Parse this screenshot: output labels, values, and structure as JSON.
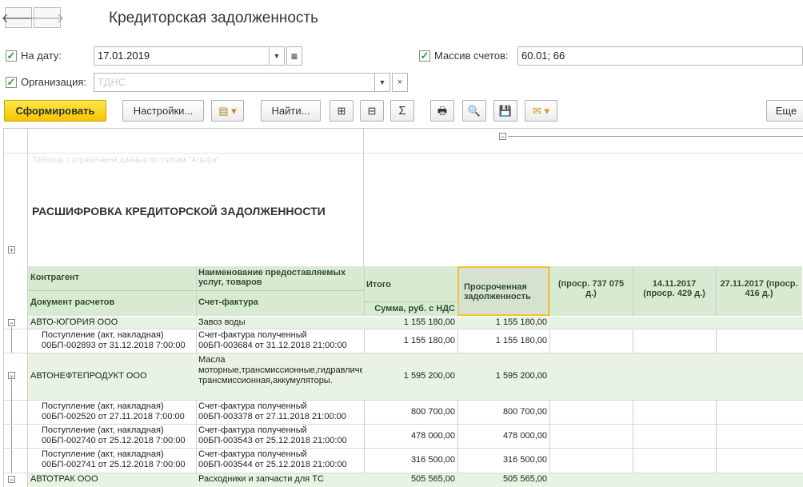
{
  "nav": {
    "back_icon": "arrow-left-icon",
    "forward_icon": "arrow-right-icon"
  },
  "window": {
    "title": "Кредиторская задолженность"
  },
  "filters": {
    "date_label": "На дату:",
    "date_value": "17.01.2019",
    "accounts_label": "Массив счетов:",
    "accounts_value": "60.01; 66",
    "org_label": "Организация:",
    "org_value": "ТДНС"
  },
  "toolbar": {
    "generate": "Сформировать",
    "settings": "Настройки...",
    "find": "Найти...",
    "sum_symbol": "Σ",
    "more": "Еще"
  },
  "report": {
    "subtitle": "Таблица с отражением данных по счетам \"Альфа\"",
    "title": "РАСШИФРОВКА КРЕДИТОРСКОЙ ЗАДОЛЖЕННОСТИ",
    "columns": {
      "counterparty": "Контрагент",
      "doc": "Документ расчетов",
      "service": "Наименование предоставляемых услуг, товаров",
      "invoice": "Счет-фактура",
      "total": "Итого",
      "sum": "Сумма, руб. с НДС",
      "overdue": "Просроченная задолженность",
      "c1": "(проср. 737 075 д.)",
      "c2": "14.11.2017 (проср. 429 д.)",
      "c3": "27.11.2017 (проср. 416 д.)"
    },
    "rows": [
      {
        "a": "АВТО-ЮГОРИЯ ООО",
        "b": "Завоз воды",
        "t": "1 155 180,00",
        "o": "1 155 180,00"
      },
      {
        "a": "Поступление (акт, накладная)",
        "a2": "00БП-002893 от 31.12.2018 7:00:00",
        "b": "Счет-фактура полученный",
        "b2": "00БП-003684 от 31.12.2018 21:00:00",
        "t": "1 155 180,00",
        "o": "1 155 180,00"
      },
      {
        "a": "АВТОНЕФТЕПРОДУКТ ООО",
        "b": "Масла моторные,трансмиссионные,гидравлические,жидкость трансмиссионная,аккумуляторы.",
        "t": "1 595 200,00",
        "o": "1 595 200,00"
      },
      {
        "a": "Поступление (акт, накладная)",
        "a2": "00БП-002520 от 27.11.2018 7:00:00",
        "b": "Счет-фактура полученный",
        "b2": "00БП-003378 от 27.11.2018 21:00:00",
        "t": "800 700,00",
        "o": "800 700,00"
      },
      {
        "a": "Поступление (акт, накладная)",
        "a2": "00БП-002740 от 25.12.2018 7:00:00",
        "b": "Счет-фактура полученный",
        "b2": "00БП-003543 от 25.12.2018 21:00:00",
        "t": "478 000,00",
        "o": "478 000,00"
      },
      {
        "a": "Поступление (акт, накладная)",
        "a2": "00БП-002741 от 25.12.2018 7:00:00",
        "b": "Счет-фактура полученный",
        "b2": "00БП-003544 от 25.12.2018 21:00:00",
        "t": "316 500,00",
        "o": "316 500,00"
      },
      {
        "a": "АВТОТРАК ООО",
        "b": "Расходники и запчасти для ТС",
        "t": "505 565,00",
        "o": "505 565,00"
      }
    ]
  }
}
